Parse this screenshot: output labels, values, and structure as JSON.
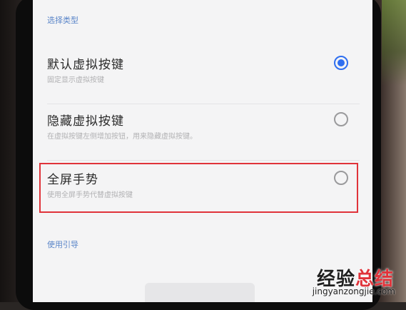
{
  "settings": {
    "section_header": "选择类型",
    "options": [
      {
        "title": "默认虚拟按键",
        "description": "固定显示虚拟按键",
        "selected": true
      },
      {
        "title": "隐藏虚拟按键",
        "description": "在虚拟按键左侧增加按钮，用来隐藏虚拟按键。",
        "selected": false
      },
      {
        "title": "全屏手势",
        "description": "使用全屏手势代替虚拟按键",
        "selected": false
      }
    ],
    "guide_link": "使用引导"
  },
  "watermark": {
    "brand_main": "经验",
    "brand_accent": "总结",
    "url": "jingyanzongjie.com"
  },
  "colors": {
    "accent_blue": "#2f6ff0",
    "link_blue": "#5b86c9",
    "highlight_red": "#e0333a"
  },
  "icons": {
    "radio_selected": "radio-checked-icon",
    "radio_unselected": "radio-unchecked-icon"
  }
}
